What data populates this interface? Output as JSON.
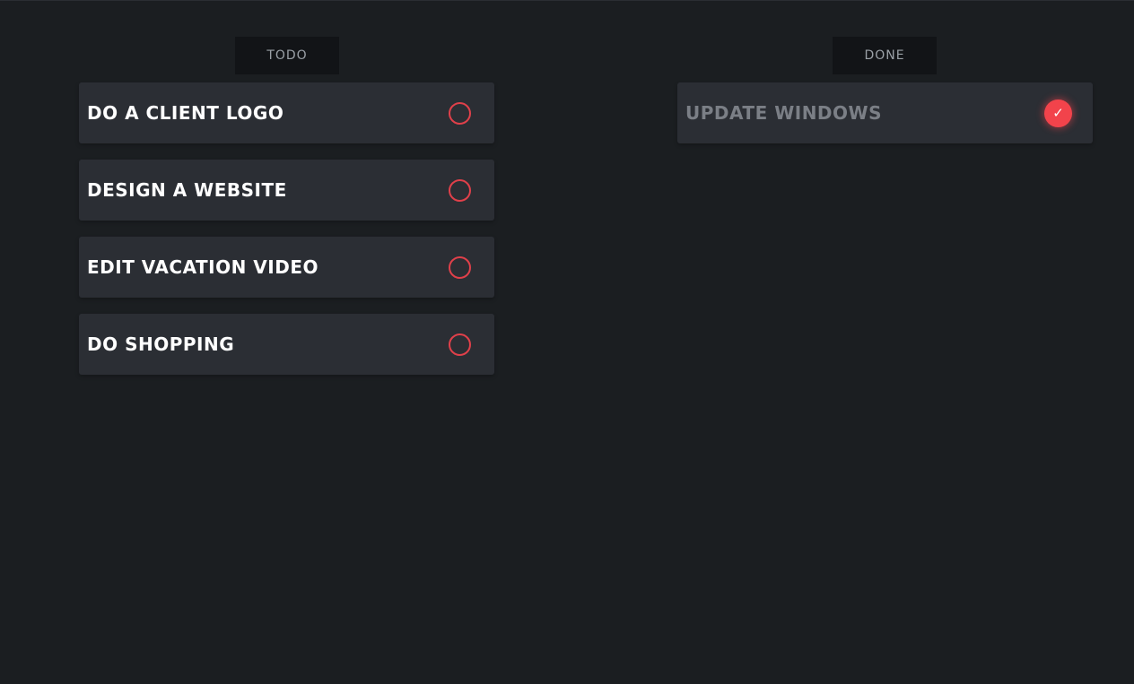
{
  "columns": {
    "todo": {
      "header": "TODO",
      "items": [
        {
          "label": "DO A CLIENT LOGO",
          "done": false
        },
        {
          "label": "DESIGN A WEBSITE",
          "done": false
        },
        {
          "label": "EDIT VACATION VIDEO",
          "done": false
        },
        {
          "label": "DO SHOPPING",
          "done": false
        }
      ]
    },
    "done": {
      "header": "DONE",
      "items": [
        {
          "label": "UPDATE WINDOWS",
          "done": true
        }
      ]
    }
  },
  "icons": {
    "pending": "empty-circle-icon",
    "completed": "checkmark-icon",
    "checkmark_glyph": "✓"
  },
  "colors": {
    "background": "#1b1e21",
    "card": "#2b2e34",
    "header_bg": "#121417",
    "accent": "#f2434b",
    "text": "#ffffff",
    "muted_text": "#7b7f86"
  }
}
